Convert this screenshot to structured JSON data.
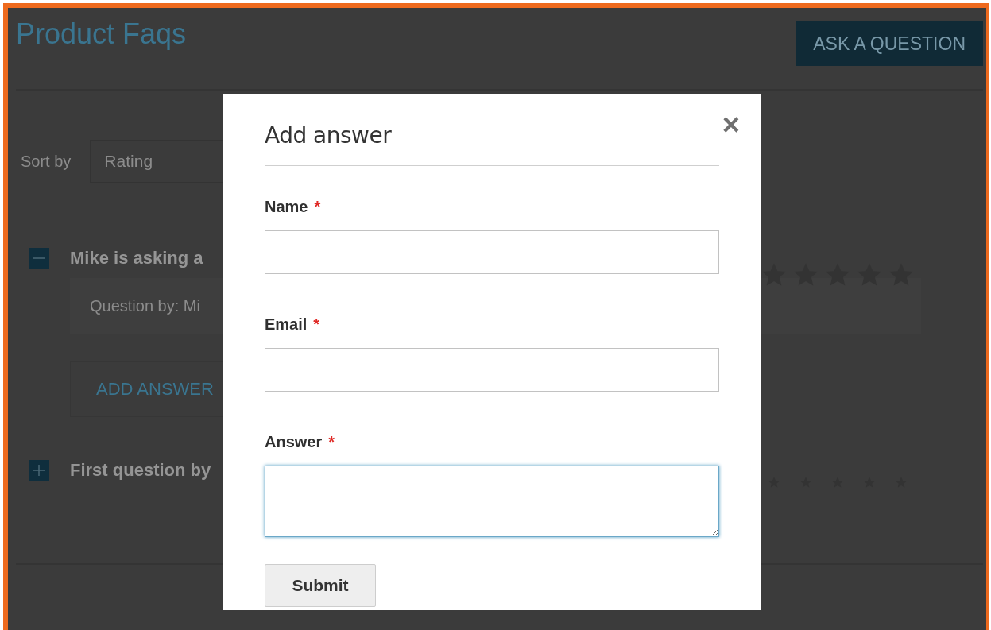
{
  "page": {
    "title": "Product Faqs",
    "ask_button": "ASK A QUESTION",
    "sort_label": "Sort by",
    "sort_value": "Rating"
  },
  "questions": [
    {
      "title": "Mike is asking a",
      "expanded": true,
      "meta": "Question by: Mi",
      "add_answer": "ADD ANSWER"
    },
    {
      "title": "First question by",
      "expanded": false
    }
  ],
  "dialog": {
    "title": "Add answer",
    "close": "×",
    "fields": [
      {
        "label": "Name",
        "required_mark": "*",
        "kind": "input",
        "focused": false
      },
      {
        "label": "Email",
        "required_mark": "*",
        "kind": "input",
        "focused": false
      },
      {
        "label": "Answer",
        "required_mark": "*",
        "kind": "textarea",
        "focused": true
      }
    ],
    "submit": "Submit"
  }
}
